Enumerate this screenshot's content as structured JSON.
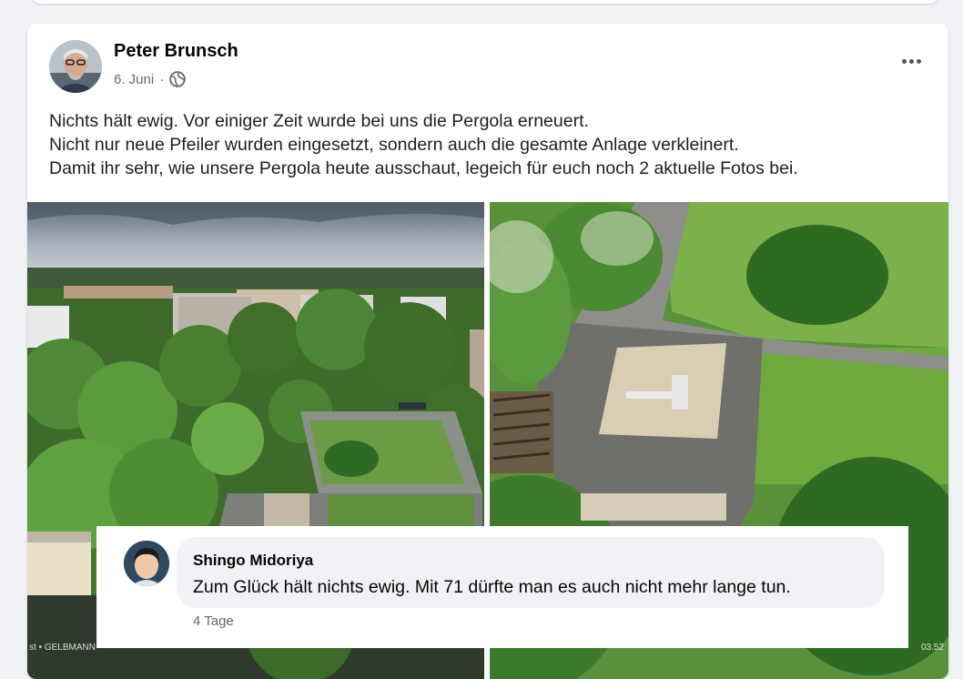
{
  "post": {
    "author": "Peter Brunsch",
    "date": "6. Juni",
    "separator": "·",
    "privacy_icon": "globe-icon",
    "more_icon": "more-options-icon",
    "text_lines": [
      "Nichts hält ewig. Vor einiger Zeit wurde bei uns die Pergola erneuert.",
      "Nicht nur neue Pfeiler wurden eingesetzt, sondern auch die gesamte Anlage verkleinert.",
      "Damit ihr sehr, wie unsere Pergola heute ausschaut, legeich für euch noch 2 aktuelle Fotos bei."
    ],
    "watermark_left": "st • GELBMANN",
    "watermark_right": "03.52"
  },
  "comment": {
    "author": "Shingo Midoriya",
    "text": "Zum Glück hält nichts ewig. Mit 71 dürfte man es auch nicht mehr lange tun.",
    "time": "4 Tage"
  },
  "colors": {
    "background": "#f0f2f5",
    "card": "#ffffff",
    "secondary_text": "#65676b",
    "comment_bubble": "#f0f2f5"
  }
}
